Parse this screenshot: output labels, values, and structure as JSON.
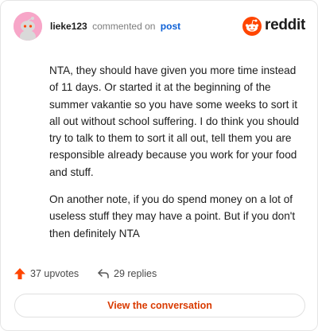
{
  "header": {
    "username": "lieke123",
    "action_text": "commented on",
    "post_link": "post",
    "brand": "reddit"
  },
  "comment": {
    "paragraphs": [
      "NTA, they should have given you more time instead of 11 days. Or started it at the beginning of the summer vakantie so you have some weeks to sort it all out without school suffering. I do think you should try to talk to them to sort it all out, tell them you are responsible already because you work for your food and stuff.",
      "On another note, if you do spend money on a lot of useless stuff they may have a point. But if you don't then definitely NTA"
    ]
  },
  "actions": {
    "upvotes": "37 upvotes",
    "replies": "29 replies"
  },
  "cta": {
    "label": "View the conversation"
  },
  "colors": {
    "brand_orange": "#ff4500",
    "cta_text": "#d93a00",
    "avatar_bg": "#f7a6c8",
    "link_blue": "#0b5fd6"
  },
  "icons": [
    "avatar",
    "reddit-logo-icon",
    "upvote-arrow-icon",
    "reply-arrow-icon"
  ]
}
